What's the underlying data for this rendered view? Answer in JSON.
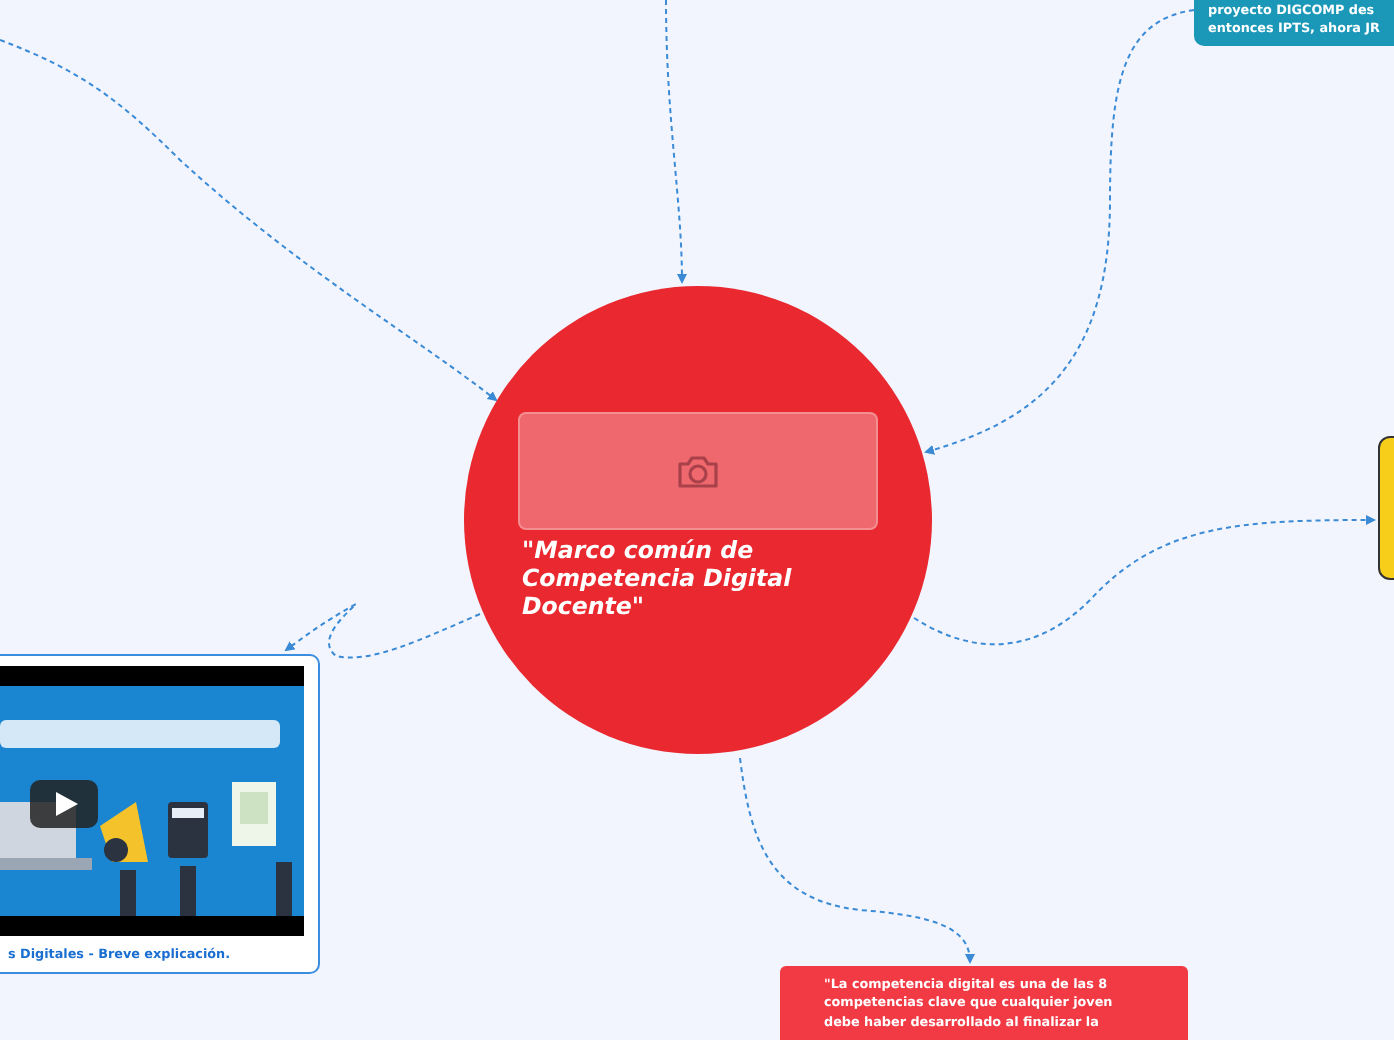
{
  "central_topic": {
    "title": "\"Marco común de Competencia Digital Docente\"",
    "color": "#e9282f"
  },
  "topics": [
    {
      "kind": "text",
      "color": "#1b98b8",
      "lines": [
        "proyecto DIGCOMP des",
        "entonces IPTS, ahora JR"
      ]
    },
    {
      "kind": "video",
      "color": "#3b8de0",
      "caption": "s Digitales - Breve explicación."
    },
    {
      "kind": "text",
      "color": "#f23a44",
      "lines": [
        "\"La competencia digital es una de las 8",
        "competencias clave que cualquier joven",
        "debe haber desarrollado al finalizar la"
      ]
    },
    {
      "kind": "blank",
      "color": "#f7cf1b"
    }
  ]
}
